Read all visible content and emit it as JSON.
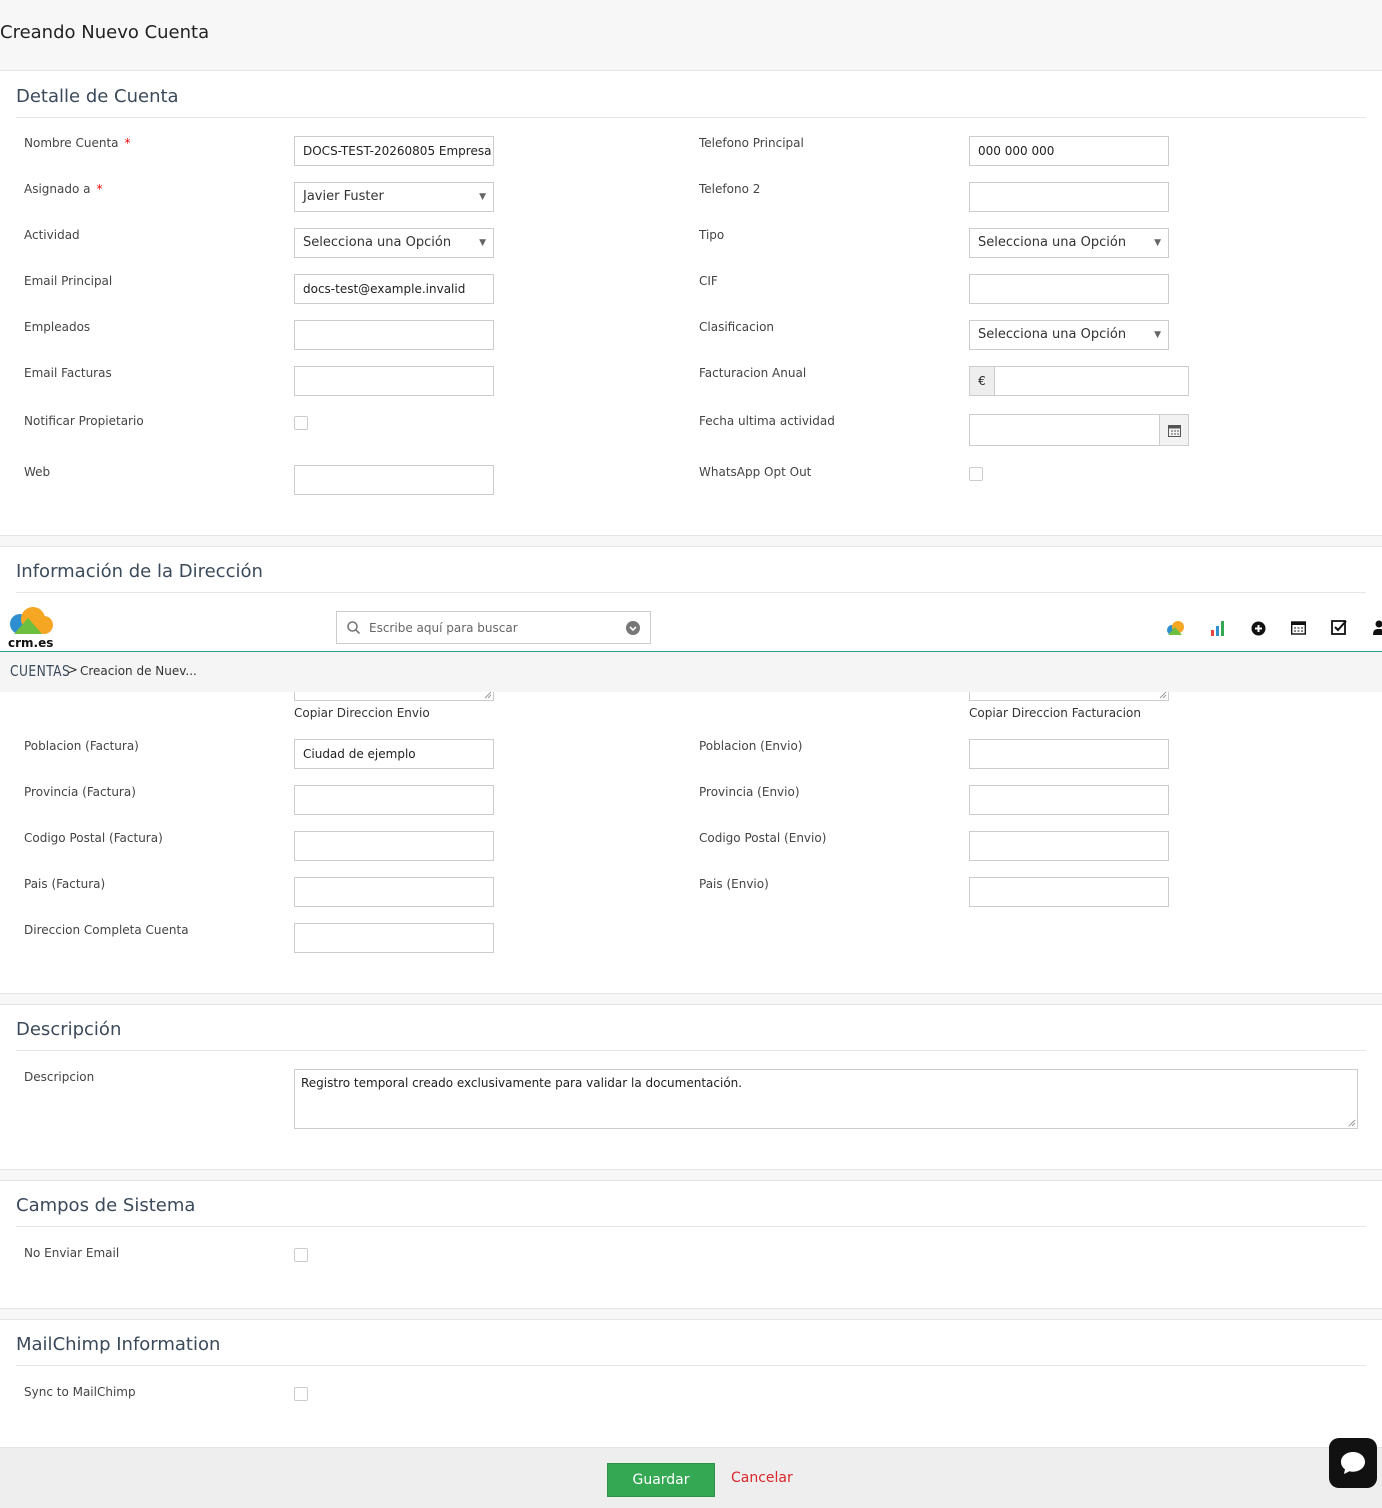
{
  "page": {
    "title": "Creando Nuevo Cuenta"
  },
  "header": {
    "logo_text": "crm.es",
    "search_placeholder": "Escribe aquí para buscar",
    "breadcrumb_module": "CUENTAS",
    "breadcrumb_separator": ">",
    "breadcrumb_current": "Creacion de Nuev..."
  },
  "account": {
    "title": "Detalle de Cuenta",
    "name_label": "Nombre Cuenta",
    "required_mark": "*",
    "name_value": "DOCS-TEST-20260805 Empresa",
    "assigned_label": "Asignado a",
    "assigned_value": "Javier Fuster",
    "activity_label": "Actividad",
    "select_placeholder": "Selecciona una Opción",
    "email_label": "Email Principal",
    "email_value": "docs-test@example.invalid",
    "employees_label": "Empleados",
    "invoice_email_label": "Email Facturas",
    "notify_label": "Notificar Propietario",
    "web_label": "Web",
    "phone_label": "Telefono Principal",
    "phone_value": "000 000 000",
    "phone2_label": "Telefono 2",
    "type_label": "Tipo",
    "cif_label": "CIF",
    "classification_label": "Clasificacion",
    "revenue_label": "Facturacion Anual",
    "currency_symbol": "€",
    "last_activity_label": "Fecha ultima actividad",
    "whatsapp_label": "WhatsApp Opt Out"
  },
  "address": {
    "title": "Información de la Dirección",
    "copy_shipping": "Copiar Direccion Envio",
    "copy_billing": "Copiar Direccion Facturacion",
    "city_bill_label": "Poblacion (Factura)",
    "city_bill_value": "Ciudad de ejemplo",
    "province_bill_label": "Provincia (Factura)",
    "zip_bill_label": "Codigo Postal (Factura)",
    "country_bill_label": "Pais (Factura)",
    "full_address_label": "Direccion Completa Cuenta",
    "city_ship_label": "Poblacion (Envio)",
    "province_ship_label": "Provincia (Envio)",
    "zip_ship_label": "Codigo Postal (Envio)",
    "country_ship_label": "Pais (Envio)"
  },
  "description": {
    "title": "Descripción",
    "label": "Descripcion",
    "value": "Registro temporal creado exclusivamente para validar la documentación."
  },
  "system": {
    "title": "Campos de Sistema",
    "no_email_label": "No Enviar Email"
  },
  "mailchimp": {
    "title": "MailChimp Information",
    "sync_label": "Sync to MailChimp"
  },
  "footer": {
    "save_label": "Guardar",
    "cancel_label": "Cancelar"
  },
  "colors": {
    "accent": "#35a853",
    "cancel": "#d9262c",
    "header_rule": "#2aa08a"
  }
}
